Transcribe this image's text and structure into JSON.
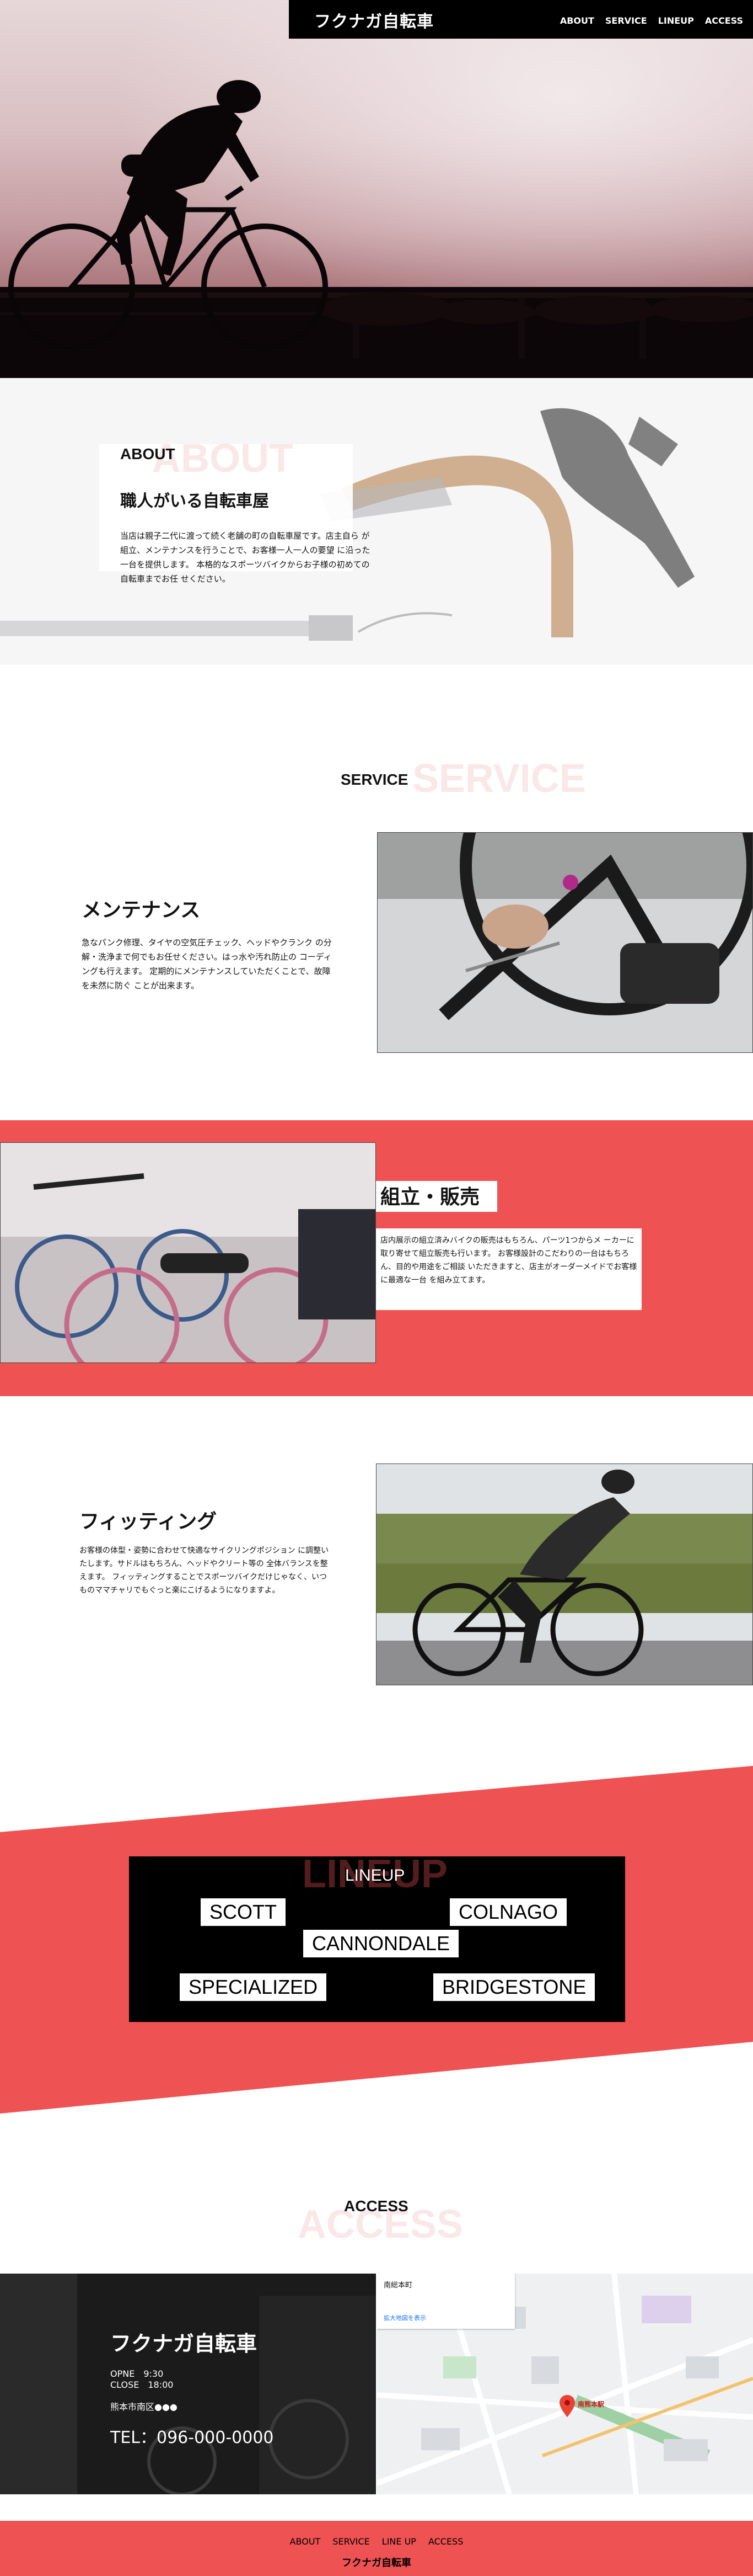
{
  "header": {
    "logo": "フクナガ自転車",
    "nav": [
      "ABOUT",
      "SERVICE",
      "LINEUP",
      "ACCESS"
    ]
  },
  "about": {
    "title": "ABOUT",
    "ghost": "ABOUT",
    "subtitle": "職人がいる自転車屋",
    "text": "当店は親子二代に渡って続く老舗の町の自転車屋です。店主自ら が組立、メンテナンスを行うことで、お客様一人一人の要望 に沿った一台を提供します。 本格的なスポーツバイクからお子様の初めての自転車までお任 せください。"
  },
  "service": {
    "title": "SERVICE",
    "ghost": "SERVICE",
    "maintenance": {
      "title": "メンテナンス",
      "text": "急なパンク修理、タイヤの空気圧チェック、ヘッドやクランク の分解・洗浄まで何でもお任せください。はっ水や汚れ防止の コーディングも行えます。 定期的にメンテナンスしていただくことで、故障を未然に防ぐ ことが出来ます。"
    },
    "assembly": {
      "title": "組立・販売",
      "text": "店内展示の組立済みバイクの販売はもちろん、パーツ1つからメ ーカーに取り寄せて組立販売も行います。 お客様設計のこだわりの一台はもちろん、目的や用途をご相談 いただきますと、店主がオーダーメイドでお客様に最適な一台 を組み立てます。"
    },
    "fitting": {
      "title": "フィッティング",
      "text": "お客様の体型・姿勢に合わせて快適なサイクリングポジション に調整いたします。サドルはもちろん、ヘッドやクリート等の 全体バランスを整えます。 フィッティングすることでスポーツバイクだけじゃなく、いつ ものママチャリでもぐっと楽にこげるようになりますよ。"
    }
  },
  "lineup": {
    "title": "LINEUP",
    "ghost": "LINEUP",
    "brands": [
      "SCOTT",
      "COLNAGO",
      "CANNONDALE",
      "SPECIALIZED",
      "BRIDGESTONE"
    ]
  },
  "access": {
    "title": "ACCESS",
    "ghost": "ACCESS",
    "shop_name": "フクナガ自転車",
    "open": "OPNE　9:30",
    "close": "CLOSE　18:00",
    "address": "熊本市南区●●●",
    "tel": "TEL：096-000-0000",
    "map_place": "南総本町",
    "map_pin_label": "南熊本駅",
    "map_link": "拡大地図を表示"
  },
  "footer": {
    "nav": [
      "ABOUT",
      "SERVICE",
      "LINE UP",
      "ACCESS"
    ],
    "logo": "フクナガ自転車"
  },
  "colors": {
    "accent": "#ee5252",
    "dark": "#000000"
  }
}
